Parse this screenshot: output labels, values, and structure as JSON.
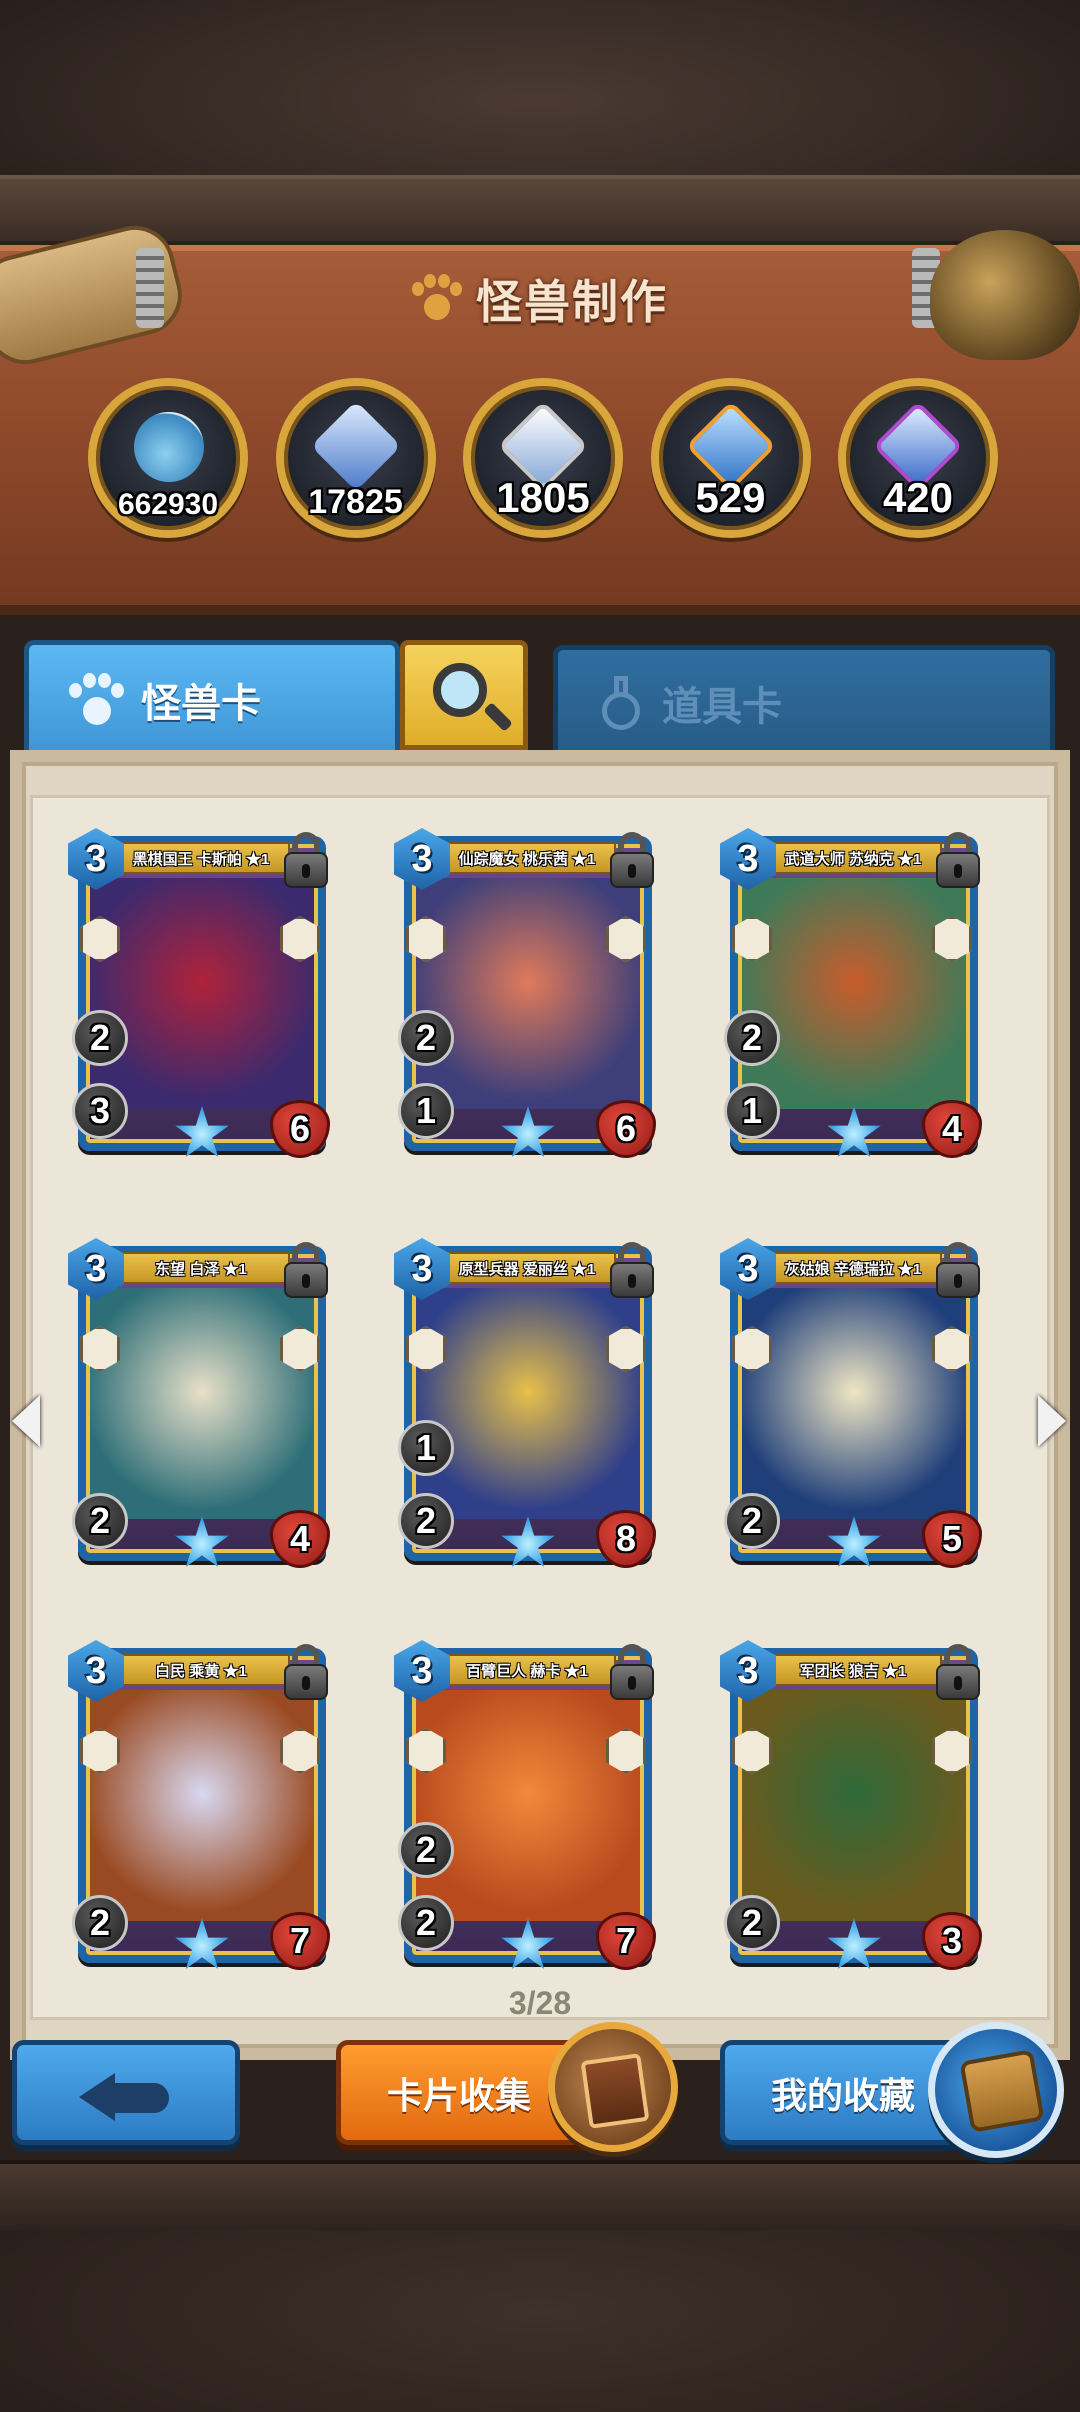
{
  "header": {
    "title": "怪兽制作"
  },
  "resources": [
    {
      "name": "dust-bottle",
      "value": "662930",
      "color": "#6fc0ea"
    },
    {
      "name": "common-gem",
      "value": "17825",
      "color": "#6a8fcf"
    },
    {
      "name": "silver-gem",
      "value": "1805",
      "color": "#a9c8f0"
    },
    {
      "name": "gold-gem",
      "value": "529",
      "color": "#f0a030"
    },
    {
      "name": "rainbow-gem",
      "value": "420",
      "color": "#9a5fd0"
    }
  ],
  "tabs": {
    "monster": "怪兽卡",
    "items": "道具卡"
  },
  "cards": [
    {
      "name": "黑棋国王 卡斯帕 ★1",
      "cost": "3",
      "atk": "2",
      "sta": "3",
      "hp": "6",
      "art": [
        "#3b2a6e",
        "#b0223a"
      ]
    },
    {
      "name": "仙踪魔女 桃乐茜 ★1",
      "cost": "3",
      "atk": "2",
      "sta": "1",
      "hp": "6",
      "art": [
        "#3e3f7a",
        "#e07a5a"
      ]
    },
    {
      "name": "武道大师 苏纳克 ★1",
      "cost": "3",
      "atk": "2",
      "sta": "1",
      "hp": "4",
      "art": [
        "#3f7a58",
        "#c85c2c"
      ]
    },
    {
      "name": "东望 白泽 ★1",
      "cost": "3",
      "atk": "",
      "sta": "2",
      "hp": "4",
      "art": [
        "#2d6e78",
        "#e8e0c8"
      ]
    },
    {
      "name": "原型兵器 爱丽丝 ★1",
      "cost": "3",
      "atk": "1",
      "sta": "2",
      "hp": "8",
      "art": [
        "#2f3f8a",
        "#e8c04a"
      ]
    },
    {
      "name": "灰姑娘 辛德瑞拉 ★1",
      "cost": "3",
      "atk": "",
      "sta": "2",
      "hp": "5",
      "art": [
        "#1f3f7a",
        "#f0e6c4"
      ]
    },
    {
      "name": "白民 乘黄 ★1",
      "cost": "3",
      "atk": "",
      "sta": "2",
      "hp": "7",
      "art": [
        "#9a4a22",
        "#d8d8f0"
      ]
    },
    {
      "name": "百臂巨人 赫卡 ★1",
      "cost": "3",
      "atk": "2",
      "sta": "2",
      "hp": "7",
      "art": [
        "#b84a1e",
        "#f08a3a"
      ]
    },
    {
      "name": "军团长 狼吉 ★1",
      "cost": "3",
      "atk": "",
      "sta": "2",
      "hp": "3",
      "art": [
        "#6a5a1e",
        "#2f6a3a"
      ]
    }
  ],
  "pager": "3/28",
  "buttons": {
    "collect": "卡片收集",
    "favorites": "我的收藏"
  }
}
